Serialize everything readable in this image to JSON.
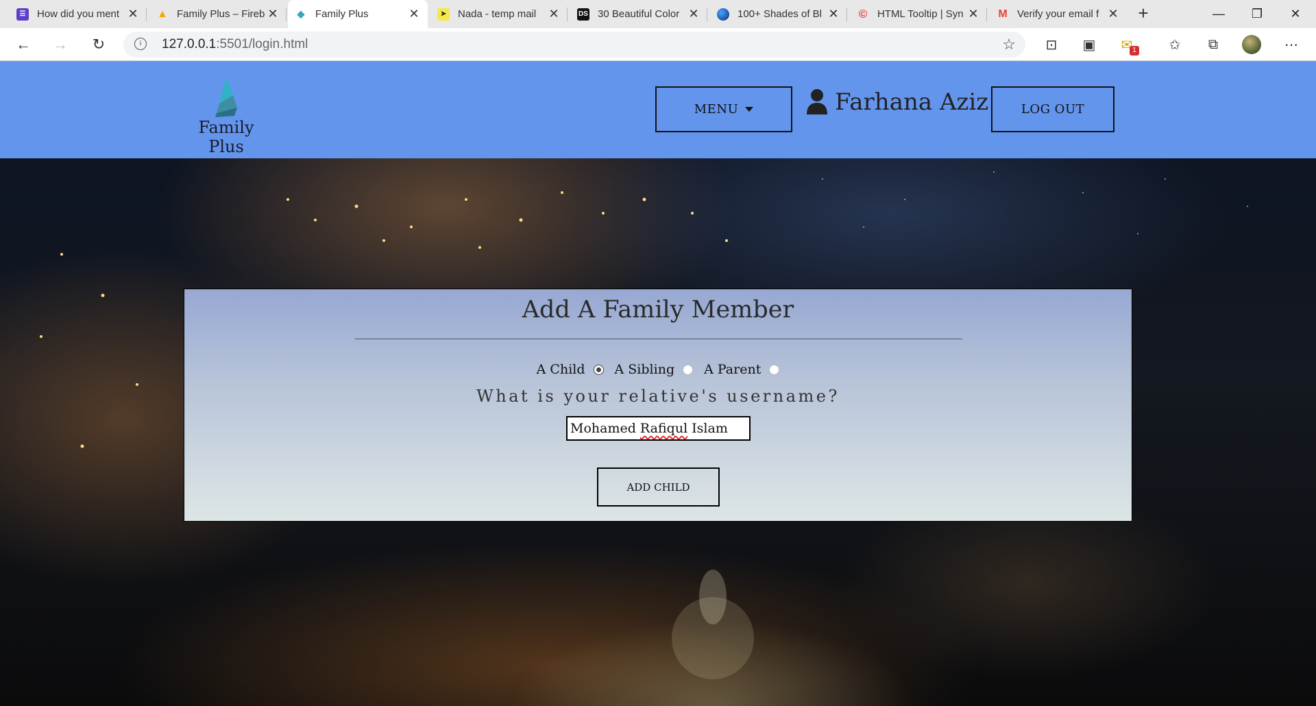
{
  "browser": {
    "tabs": [
      {
        "title": "How did you ment",
        "icon": "forms-icon",
        "color": "#5b3fc4"
      },
      {
        "title": "Family Plus – Fireb",
        "icon": "firebase-icon",
        "color": "#f6a800"
      },
      {
        "title": "Family Plus",
        "icon": "family-plus-icon",
        "color": "#38a6b8",
        "active": true
      },
      {
        "title": "Nada - temp mail",
        "icon": "nada-icon",
        "color": "#f3e94a"
      },
      {
        "title": "30 Beautiful Color",
        "icon": "ds-icon",
        "color": "#111111"
      },
      {
        "title": "100+ Shades of Bl",
        "icon": "globe-icon",
        "color": "#1f5fbf"
      },
      {
        "title": "HTML Tooltip | Syn",
        "icon": "syncfusion-icon",
        "color": "#e53935"
      },
      {
        "title": "Verify your email f",
        "icon": "gmail-icon",
        "color": "#ea4335"
      }
    ],
    "url_host": "127.0.0.1",
    "url_rest": ":5501/login.html",
    "mail_badge": "1"
  },
  "header": {
    "logo_text": "Family Plus",
    "menu_label": "MENU",
    "user_name": "Farhana Aziz",
    "logout_label": "LOG OUT",
    "bg_color": "#6495ed"
  },
  "card": {
    "title": "Add A Family Member",
    "options": [
      {
        "label": "A Child",
        "selected": true
      },
      {
        "label": "A Sibling",
        "selected": false
      },
      {
        "label": "A Parent",
        "selected": false
      }
    ],
    "question": "What is your relative's username?",
    "input_value_prefix": "Mohamed ",
    "input_value_misspelled": "Rafiqul",
    "input_value_suffix": " Islam",
    "submit_label": "ADD CHILD"
  }
}
